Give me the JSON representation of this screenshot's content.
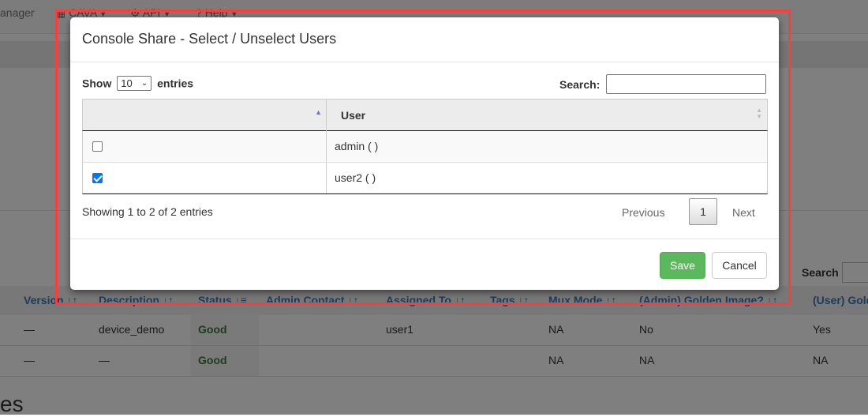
{
  "background": {
    "nav": {
      "manager_label": "anager",
      "cava_label": "CAVA",
      "api_label": "API",
      "help_label": "Help"
    },
    "search_label": "Search",
    "table": {
      "headers": [
        "Version",
        "Description",
        "Status",
        "Admin Contact",
        "Assigned To",
        "Tags",
        "Mux Mode",
        "(Admin) Golden Image?",
        "(User) Gold"
      ],
      "rows": [
        {
          "version": "—",
          "description": "device_demo",
          "status": "Good",
          "admin_contact": "",
          "assigned_to": "user1",
          "tags": "",
          "mux_mode": "NA",
          "admin_golden": "No",
          "user_golden": "Yes"
        },
        {
          "version": "—",
          "description": "—",
          "status": "Good",
          "admin_contact": "",
          "assigned_to": "",
          "tags": "",
          "mux_mode": "NA",
          "admin_golden": "NA",
          "user_golden": "NA"
        }
      ]
    },
    "heading_fragment": "es"
  },
  "modal": {
    "title": "Console Share - Select / Unselect Users",
    "length": {
      "prefix": "Show",
      "value": "10",
      "suffix": "entries"
    },
    "search": {
      "label": "Search:",
      "value": ""
    },
    "table": {
      "headers": [
        "",
        "User"
      ],
      "rows": [
        {
          "checked": false,
          "user": "admin ( )"
        },
        {
          "checked": true,
          "user": "user2 ( )"
        }
      ]
    },
    "info": "Showing 1 to 2 of 2 entries",
    "pagination": {
      "previous": "Previous",
      "current": "1",
      "next": "Next"
    },
    "save_label": "Save",
    "cancel_label": "Cancel"
  },
  "colors": {
    "overlay": "#000000",
    "highlight": "#ff3b3b",
    "save": "#5cb85c",
    "link": "#337ab7",
    "good": "#3c763d",
    "checkbox": "#0075ff"
  }
}
